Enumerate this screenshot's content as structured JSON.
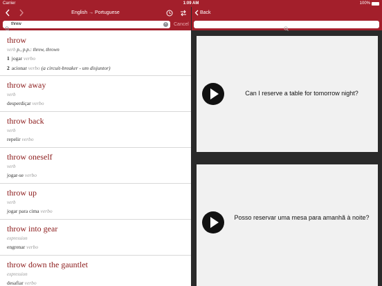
{
  "status": {
    "carrier": "Carrier",
    "time": "1:09 AM",
    "battery": "100%"
  },
  "left_nav": {
    "title": "English → Portuguese"
  },
  "search": {
    "value": "threw",
    "cancel": "Cancel"
  },
  "entries": [
    {
      "headword": "throw",
      "pos": "verb",
      "forms": "p., p.p.: threw, thrown",
      "senses": [
        {
          "num": "1",
          "text": "jogar",
          "tag": "verbo"
        },
        {
          "num": "2",
          "text": "acionar",
          "tag": "verbo",
          "example": "(a circuit-breaker - um disjuntor)"
        }
      ]
    },
    {
      "headword": "throw away",
      "pos": "verb",
      "translation": "desperdiçar",
      "tag": "verbo"
    },
    {
      "headword": "throw back",
      "pos": "verb",
      "translation": "repelir",
      "tag": "verbo"
    },
    {
      "headword": "throw oneself",
      "pos": "verb",
      "translation": "jogar-se",
      "tag": "verbo"
    },
    {
      "headword": "throw up",
      "pos": "verb",
      "translation": "jogar para cima",
      "tag": "verbo"
    },
    {
      "headword": "throw into gear",
      "pos": "expression",
      "translation": "engrenar",
      "tag": "verbo"
    },
    {
      "headword": "throw down the gauntlet",
      "pos": "expression",
      "translation": "desafiar",
      "tag": "verbo"
    }
  ],
  "right_nav": {
    "back": "Back"
  },
  "cards": [
    {
      "text": "Can I reserve a table for tomorrow night?"
    },
    {
      "text": "Posso reservar uma mesa para amanhã à noite?"
    }
  ],
  "colors": {
    "brand": "#a31f2b",
    "headword": "#8b1a1a"
  }
}
